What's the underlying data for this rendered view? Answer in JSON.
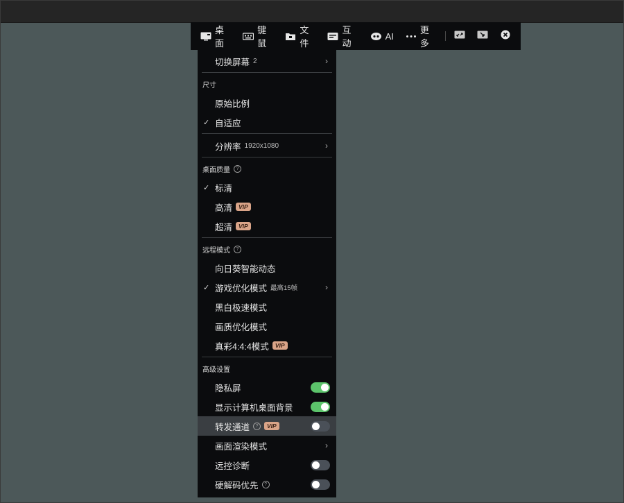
{
  "toolbar": {
    "items": [
      {
        "label": "桌面",
        "icon": "desktop-icon"
      },
      {
        "label": "键鼠",
        "icon": "keyboard-mouse-icon"
      },
      {
        "label": "文件",
        "icon": "file-icon"
      },
      {
        "label": "互动",
        "icon": "interact-icon"
      },
      {
        "label": "AI",
        "icon": "ai-eye-icon"
      },
      {
        "label": "更多",
        "icon": "more-icon"
      }
    ],
    "right_icons": [
      "expand-icon",
      "minimize-icon",
      "close-icon"
    ]
  },
  "menu": {
    "switch_screen": {
      "label": "切换屏幕",
      "value": "2"
    },
    "size": {
      "heading": "尺寸",
      "original_ratio": "原始比例",
      "adaptive": "自适应",
      "checked": "adaptive"
    },
    "resolution": {
      "label": "分辨率",
      "value": "1920x1080"
    },
    "quality": {
      "heading": "桌面质量",
      "standard": "标清",
      "high": "高清",
      "ultra": "超清",
      "checked": "standard"
    },
    "remote_mode": {
      "heading": "远程模式",
      "smart_dynamic": "向日葵智能动态",
      "game_mode": "游戏优化模式",
      "game_mode_note": "最高15帧",
      "bw_mode": "黑白极速模式",
      "image_mode": "画质优化模式",
      "truecolor_mode": "真彩4:4:4模式",
      "checked": "game_mode"
    },
    "advanced": {
      "heading": "高级设置",
      "privacy_screen": {
        "label": "隐私屏",
        "on": true
      },
      "show_wallpaper": {
        "label": "显示计算机桌面背景",
        "on": true
      },
      "relay_channel": {
        "label": "转发通道",
        "on": false
      },
      "render_mode": {
        "label": "画面渲染模式"
      },
      "remote_diagnosis": {
        "label": "远控诊断",
        "on": false
      },
      "hw_decode": {
        "label": "硬解码优先",
        "on": false
      }
    },
    "vip_label": "VIP",
    "check_mark": "✓",
    "arrow": "›",
    "help_mark": "?"
  },
  "colors": {
    "background": "#4c5859",
    "panel": "#0b0c0e",
    "toggle_on": "#5cc46b",
    "toggle_off": "#4a5058",
    "vip_badge": "#d9a488",
    "highlight_row": "#3a3e42"
  }
}
